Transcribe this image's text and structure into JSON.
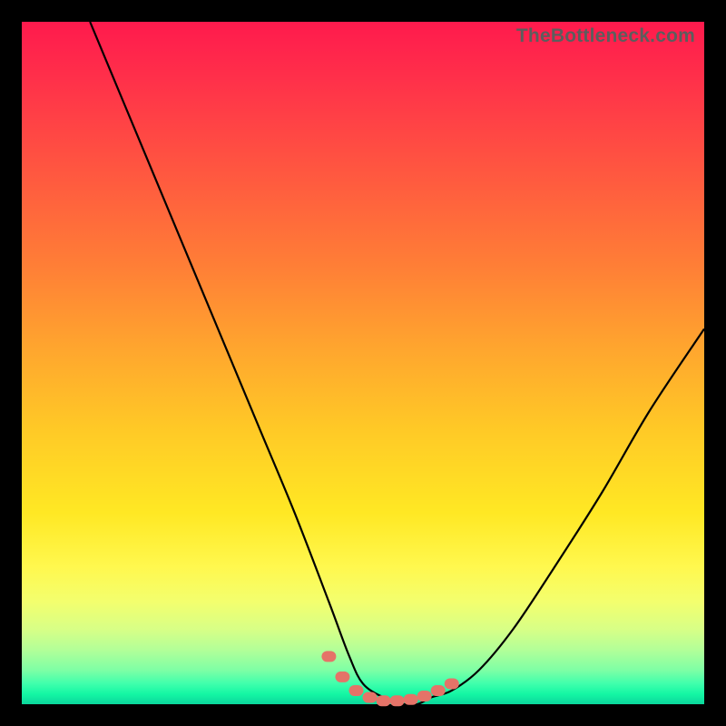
{
  "watermark": "TheBottleneck.com",
  "chart_data": {
    "type": "line",
    "title": "",
    "xlabel": "",
    "ylabel": "",
    "xlim": [
      0,
      100
    ],
    "ylim": [
      0,
      100
    ],
    "grid": false,
    "legend": false,
    "note": "Axes are unlabeled; values are estimated pixel-normalized percentages (0–100). y≈0 corresponds to the green bottom band (minimum bottleneck), y≈100 to the red top (maximum).",
    "series": [
      {
        "name": "bottleneck-curve",
        "x": [
          10,
          15,
          20,
          25,
          30,
          35,
          40,
          45,
          48,
          50,
          53,
          56,
          58,
          60,
          63,
          67,
          72,
          78,
          85,
          92,
          100
        ],
        "y": [
          100,
          88,
          76,
          64,
          52,
          40,
          28,
          15,
          7,
          3,
          1,
          0,
          0,
          1,
          2,
          5,
          11,
          20,
          31,
          43,
          55
        ]
      }
    ],
    "markers": {
      "name": "highlight-dots",
      "x": [
        45,
        47,
        49,
        51,
        53,
        55,
        57,
        59,
        61,
        63
      ],
      "y": [
        7,
        4,
        2,
        1,
        0.5,
        0.5,
        0.7,
        1.2,
        2,
        3
      ]
    },
    "background_gradient": {
      "top_color": "#ff1a4d",
      "mid_color": "#ffe824",
      "bottom_color": "#0bd69c"
    }
  }
}
